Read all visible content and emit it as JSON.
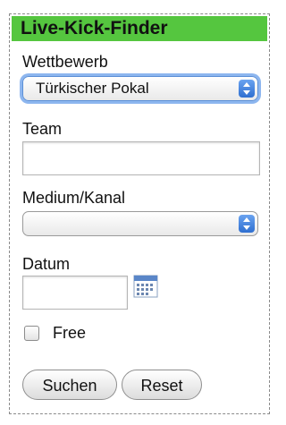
{
  "header": {
    "title": "Live-Kick-Finder",
    "color": "#55c63f"
  },
  "competition": {
    "label": "Wettbewerb",
    "selected": "Türkischer Pokal"
  },
  "team": {
    "label": "Team",
    "value": ""
  },
  "channel": {
    "label": "Medium/Kanal",
    "selected": ""
  },
  "date": {
    "label": "Datum",
    "value": "",
    "icon": "calendar-icon"
  },
  "free": {
    "label": "Free",
    "checked": false
  },
  "buttons": {
    "search": "Suchen",
    "reset": "Reset"
  }
}
